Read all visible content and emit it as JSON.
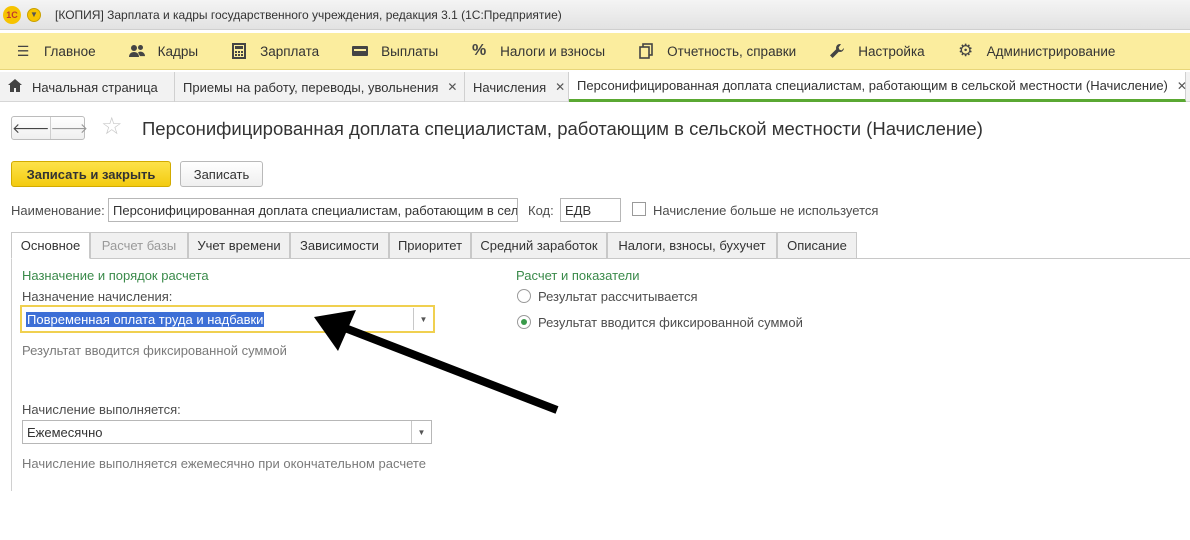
{
  "window": {
    "title": "[КОПИЯ] Зарплата и кадры государственного учреждения, редакция 3.1  (1С:Предприятие)",
    "logo_text": "1С"
  },
  "sections": [
    {
      "label": "Главное",
      "icon": "menu-lines-icon"
    },
    {
      "label": "Кадры",
      "icon": "people-icon"
    },
    {
      "label": "Зарплата",
      "icon": "calculator-icon"
    },
    {
      "label": "Выплаты",
      "icon": "wallet-icon"
    },
    {
      "label": "Налоги и взносы",
      "icon": "percent-icon"
    },
    {
      "label": "Отчетность, справки",
      "icon": "documents-icon"
    },
    {
      "label": "Настройка",
      "icon": "wrench-icon"
    },
    {
      "label": "Администрирование",
      "icon": "gear-icon"
    }
  ],
  "open_tabs": [
    {
      "label": "Начальная страница",
      "icon": "home-icon"
    },
    {
      "label": "Приемы на работу, переводы, увольнения"
    },
    {
      "label": "Начисления"
    },
    {
      "label": "Персонифицированная доплата специалистам, работающим в сельской местности (Начисление)"
    }
  ],
  "form": {
    "title": "Персонифицированная доплата специалистам, работающим в сельской местности (Начисление)",
    "save_close_label": "Записать и закрыть",
    "save_label": "Записать",
    "name_label": "Наименование:",
    "name_value": "Персонифицированная доплата специалистам, работающим в сельской местности",
    "code_label": "Код:",
    "code_value": "ЕДВ",
    "unused_label": "Начисление больше не используется",
    "unused_checked": false
  },
  "form_tabs": [
    {
      "label": "Основное",
      "active": true
    },
    {
      "label": "Расчет базы",
      "disabled": true
    },
    {
      "label": "Учет времени"
    },
    {
      "label": "Зависимости"
    },
    {
      "label": "Приоритет"
    },
    {
      "label": "Средний заработок"
    },
    {
      "label": "Налоги, взносы, бухучет"
    },
    {
      "label": "Описание"
    }
  ],
  "main": {
    "purpose_group": "Назначение и порядок расчета",
    "purpose_label": "Назначение начисления:",
    "purpose_value": "Повременная оплата труда и надбавки",
    "purpose_hint": "Результат вводится фиксированной суммой",
    "schedule_label": "Начисление выполняется:",
    "schedule_value": "Ежемесячно",
    "schedule_hint": "Начисление выполняется ежемесячно при окончательном расчете",
    "calc_group": "Расчет и показатели",
    "radio_calculated": "Результат рассчитывается",
    "radio_fixed": "Результат вводится фиксированной суммой",
    "selected_radio": "fixed"
  },
  "colors": {
    "section_bar": "#fbed9e",
    "primary_button": "#f3cb10",
    "group_title": "#3a8a4a",
    "active_tab_underline": "#5aa832",
    "selection": "#3d6fd6"
  }
}
